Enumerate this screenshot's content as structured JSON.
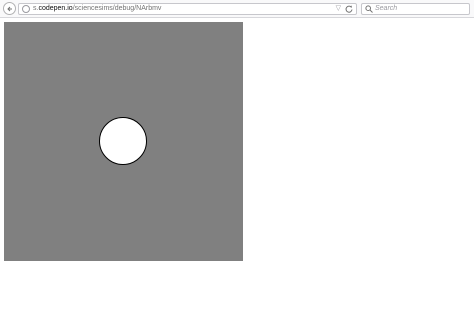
{
  "browser": {
    "url_prefix": "s.",
    "url_domain": "codepen.io",
    "url_path": "/sciencesims/debug/NArbmv",
    "search_placeholder": "Search"
  },
  "icons": [
    "back-arrow-icon",
    "info-icon",
    "dropdown-icon",
    "reload-icon",
    "search-icon"
  ],
  "colors": {
    "stage_background": "#808080",
    "circle_fill": "#ffffff",
    "circle_stroke": "#000000"
  }
}
